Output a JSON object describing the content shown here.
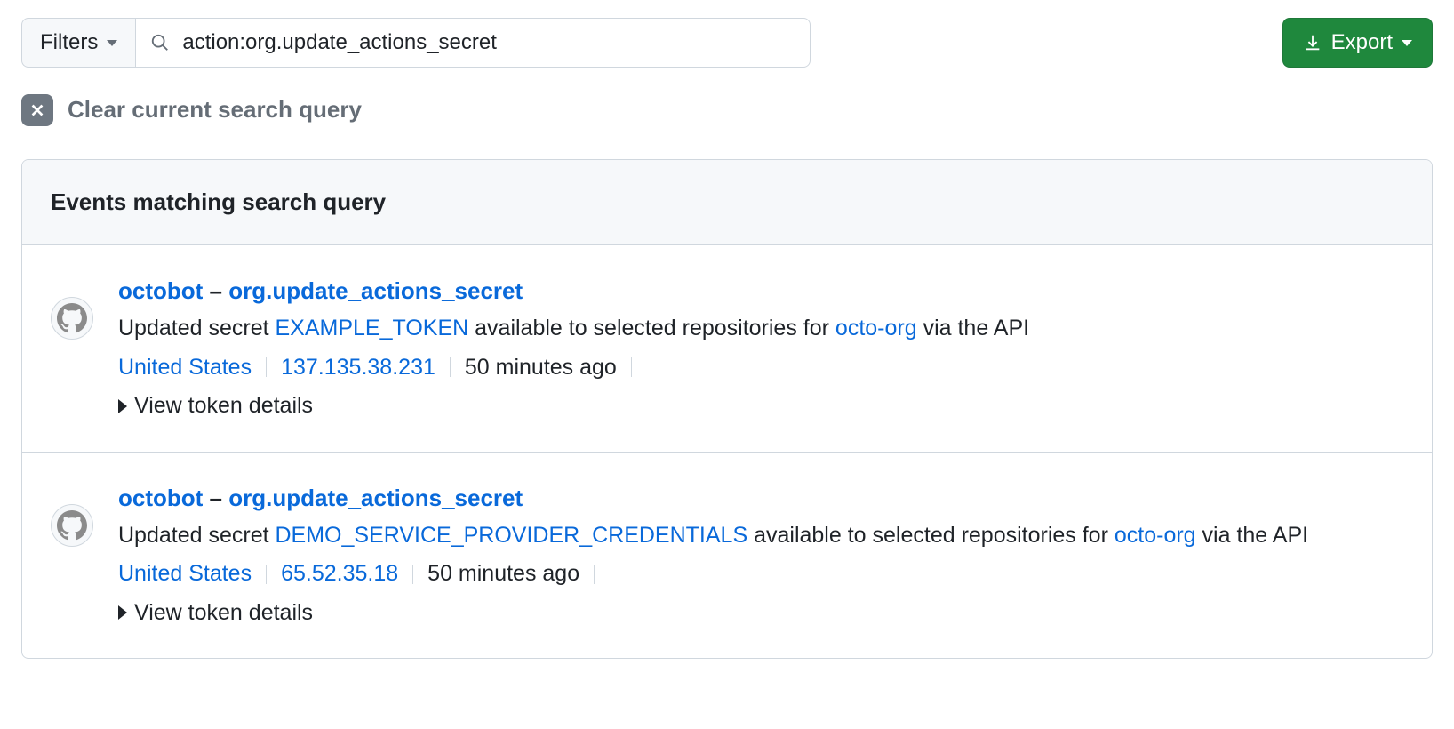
{
  "toolbar": {
    "filters_label": "Filters",
    "search_value": "action:org.update_actions_secret",
    "export_label": "Export"
  },
  "clear": {
    "label": "Clear current search query"
  },
  "results": {
    "header": "Events matching search query"
  },
  "events": [
    {
      "actor": "octobot",
      "sep": "–",
      "action": "org.update_actions_secret",
      "desc_prefix": "Updated secret ",
      "secret": "EXAMPLE_TOKEN",
      "desc_mid": " available to selected repositories for ",
      "org": "octo-org",
      "desc_suffix": " via the API",
      "location": "United States",
      "ip": "137.135.38.231",
      "time": "50 minutes ago",
      "details_label": "View token details"
    },
    {
      "actor": "octobot",
      "sep": "–",
      "action": "org.update_actions_secret",
      "desc_prefix": "Updated secret ",
      "secret": "DEMO_SERVICE_PROVIDER_CREDENTIALS",
      "desc_mid": " available to selected repositories for ",
      "org": "octo-org",
      "desc_suffix": " via the API",
      "location": "United States",
      "ip": "65.52.35.18",
      "time": "50 minutes ago",
      "details_label": "View token details"
    }
  ]
}
